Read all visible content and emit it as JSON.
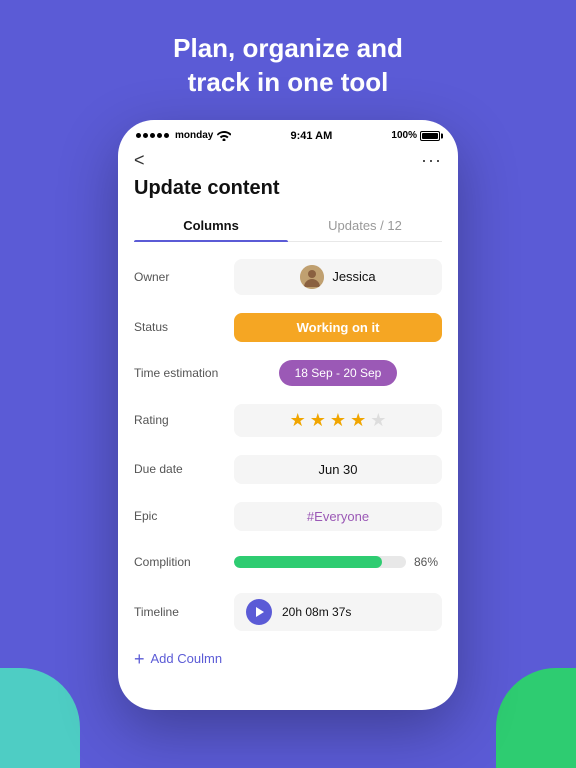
{
  "header": {
    "title": "Plan, organize and\ntrack in one tool"
  },
  "status_bar": {
    "carrier": "monday",
    "time": "9:41 AM",
    "battery": "100%"
  },
  "nav": {
    "back": "<",
    "more": "···"
  },
  "page": {
    "title": "Update content"
  },
  "tabs": [
    {
      "label": "Columns",
      "active": true
    },
    {
      "label": "Updates / 12",
      "active": false
    }
  ],
  "rows": [
    {
      "label": "Owner",
      "type": "owner",
      "value": "Jessica"
    },
    {
      "label": "Status",
      "type": "status",
      "value": "Working on it",
      "color": "#f5a623"
    },
    {
      "label": "Time estimation",
      "type": "time",
      "value": "18 Sep - 20 Sep"
    },
    {
      "label": "Rating",
      "type": "rating",
      "value": 3.5,
      "max": 5
    },
    {
      "label": "Due date",
      "type": "text",
      "value": "Jun 30"
    },
    {
      "label": "Epic",
      "type": "epic",
      "value": "#Everyone"
    },
    {
      "label": "Complition",
      "type": "progress",
      "value": 86,
      "unit": "%"
    },
    {
      "label": "Timeline",
      "type": "timeline",
      "value": "20h 08m 37s"
    }
  ],
  "add_column": {
    "label": "Add Coulmn",
    "icon": "+"
  }
}
